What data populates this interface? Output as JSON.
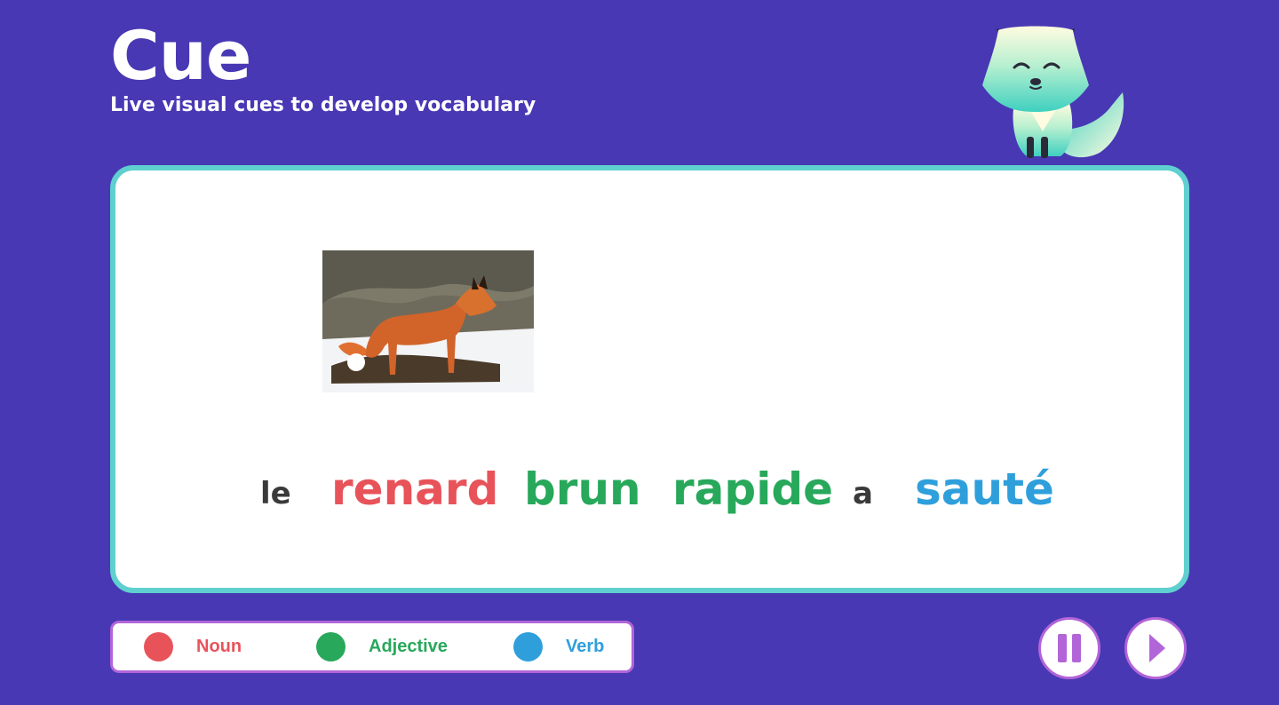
{
  "header": {
    "title": "Cue",
    "subtitle": "Live visual cues to develop vocabulary"
  },
  "mascot": {
    "icon": "fox-mascot-icon"
  },
  "card": {
    "image": {
      "icon": "red-fox-in-snow-photo"
    },
    "sentence": [
      {
        "text": "le",
        "type": "other",
        "color": "#3a3a3a"
      },
      {
        "text": "renard",
        "type": "noun",
        "color": "#e8535a"
      },
      {
        "text": "brun",
        "type": "adjective",
        "color": "#27a85a"
      },
      {
        "text": "rapide",
        "type": "adjective",
        "color": "#27a85a"
      },
      {
        "text": "a",
        "type": "other",
        "color": "#3a3a3a"
      },
      {
        "text": "sauté",
        "type": "verb",
        "color": "#2f9fdc"
      }
    ]
  },
  "legend": {
    "items": [
      {
        "label": "Noun",
        "color": "#e8535a"
      },
      {
        "label": "Adjective",
        "color": "#27a85a"
      },
      {
        "label": "Verb",
        "color": "#2f9fdc"
      }
    ]
  },
  "controls": {
    "pause": {
      "icon": "pause-icon"
    },
    "play": {
      "icon": "play-icon"
    }
  },
  "colors": {
    "background": "#4838b4",
    "card_border": "#5fd0cf",
    "accent": "#b265d8"
  }
}
